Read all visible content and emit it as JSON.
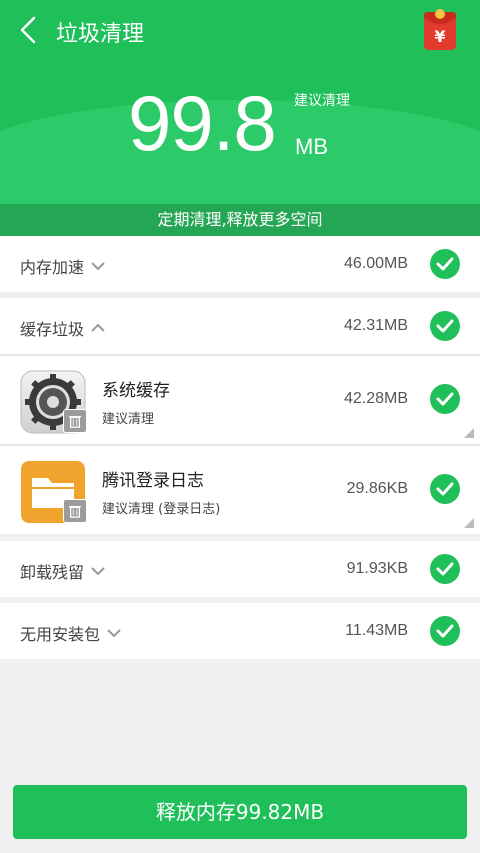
{
  "header": {
    "title": "垃圾清理",
    "total_size": "99.8",
    "unit": "MB",
    "suggest_label": "建议清理",
    "slogan": "定期清理,释放更多空间"
  },
  "categories": [
    {
      "label": "内存加速",
      "size": "46.00MB",
      "expanded": false
    },
    {
      "label": "缓存垃圾",
      "size": "42.31MB",
      "expanded": true
    },
    {
      "label": "卸载残留",
      "size": "91.93KB",
      "expanded": false
    },
    {
      "label": "无用安装包",
      "size": "11.43MB",
      "expanded": false
    }
  ],
  "cache_items": [
    {
      "name": "系统缓存",
      "sub": "建议清理",
      "size": "42.28MB",
      "icon": "settings-gear-icon"
    },
    {
      "name": "腾讯登录日志",
      "sub": "建议清理 (登录日志)",
      "size": "29.86KB",
      "icon": "folder-icon"
    }
  ],
  "action": {
    "label": "释放内存99.82MB"
  },
  "colors": {
    "primary_green": "#1fbf5a",
    "dark_green_bar": "#25a654",
    "check_green": "#1fbf5a",
    "redpacket_red": "#e33a2e"
  }
}
